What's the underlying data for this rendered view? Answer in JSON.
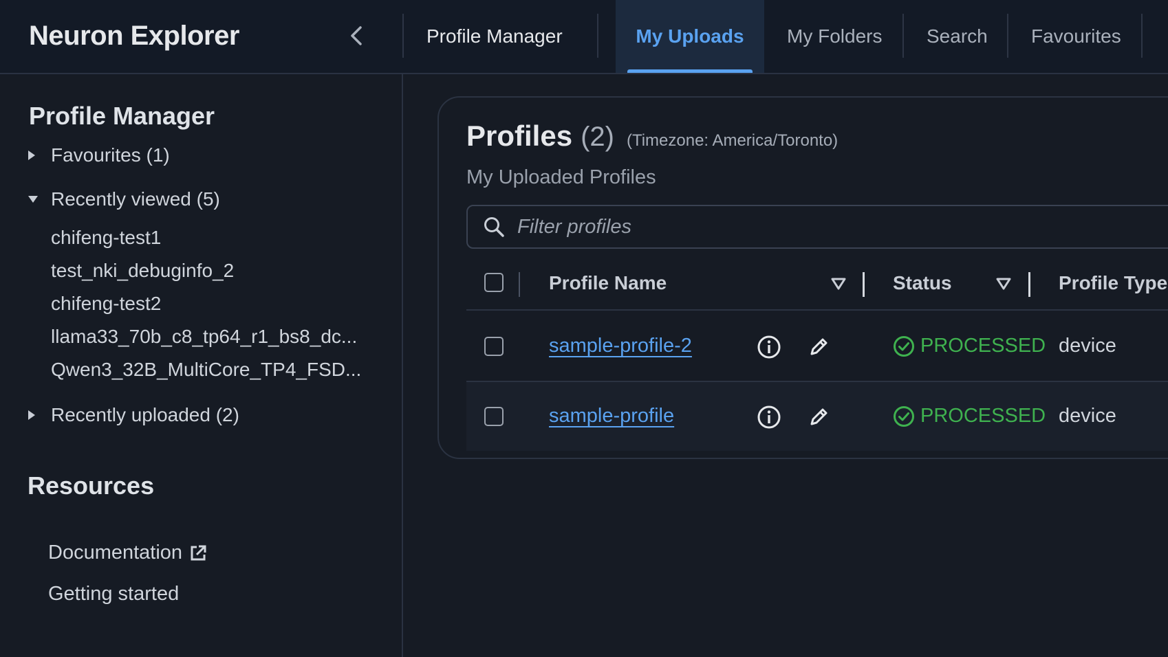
{
  "header": {
    "app_title": "Neuron Explorer",
    "tabs": [
      {
        "label": "Profile Manager"
      },
      {
        "label": "My Uploads"
      },
      {
        "label": "My Folders"
      },
      {
        "label": "Search"
      },
      {
        "label": "Favourites"
      }
    ]
  },
  "sidebar": {
    "heading": "Profile Manager",
    "groups": [
      {
        "label": "Favourites (1)",
        "expanded": false
      },
      {
        "label": "Recently viewed (5)",
        "expanded": true,
        "items": [
          "chifeng-test1",
          "test_nki_debuginfo_2",
          "chifeng-test2",
          "llama33_70b_c8_tp64_r1_bs8_dc...",
          "Qwen3_32B_MultiCore_TP4_FSD..."
        ]
      },
      {
        "label": "Recently uploaded (2)",
        "expanded": false
      }
    ],
    "resources": {
      "heading": "Resources",
      "links": [
        "Documentation",
        "Getting started"
      ]
    }
  },
  "main": {
    "title": "Profiles",
    "count": "(2)",
    "timezone": "(Timezone: America/Toronto)",
    "subtitle": "My Uploaded Profiles",
    "search_placeholder": "Filter profiles",
    "columns": [
      "Profile Name",
      "Status",
      "Profile Type"
    ],
    "rows": [
      {
        "name": "sample-profile-2",
        "status": "PROCESSED",
        "type": "device"
      },
      {
        "name": "sample-profile",
        "status": "PROCESSED",
        "type": "device"
      }
    ]
  },
  "colors": {
    "accent": "#5aa2f0",
    "status_ok": "#3fb24f",
    "background": "#161b24"
  }
}
